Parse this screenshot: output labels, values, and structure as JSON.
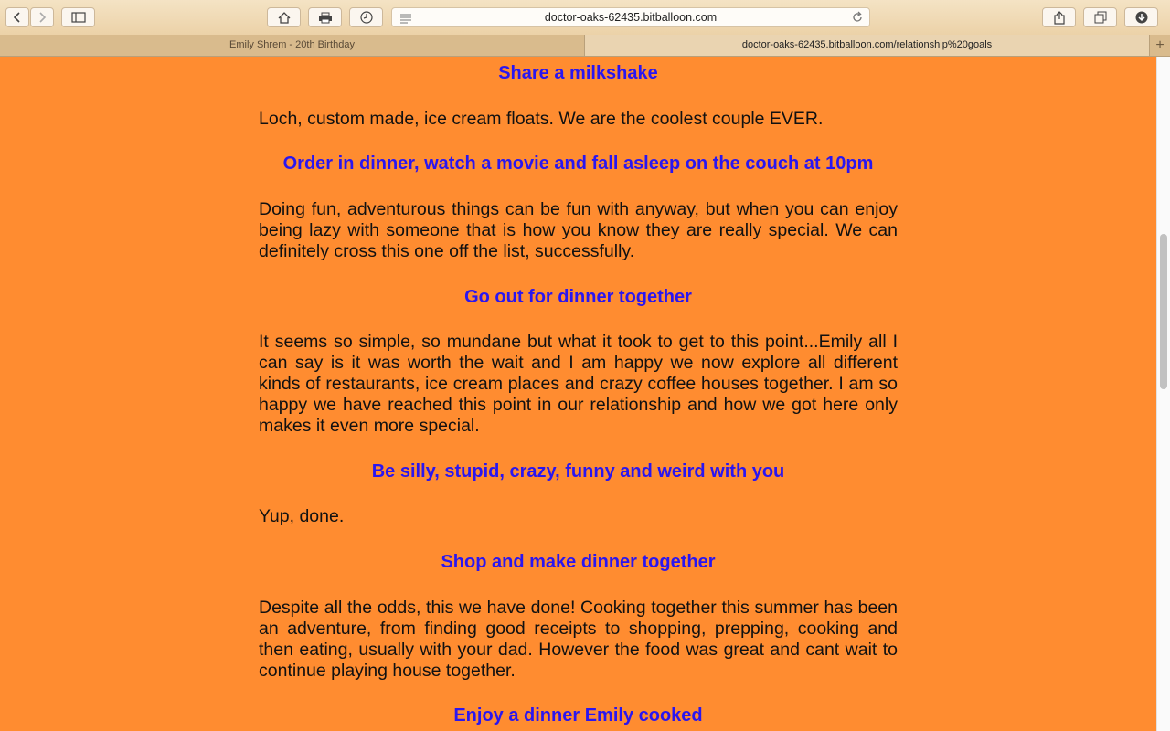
{
  "browser": {
    "url": "doctor-oaks-62435.bitballoon.com",
    "tabs": [
      {
        "label": "Emily Shrem - 20th Birthday"
      },
      {
        "label": "doctor-oaks-62435.bitballoon.com/relationship%20goals"
      }
    ],
    "new_tab": "+"
  },
  "sections": [
    {
      "heading": "Share a milkshake",
      "body": "Loch, custom made, ice cream floats. We are the coolest couple EVER."
    },
    {
      "heading": "Order in dinner, watch a movie and fall asleep on the couch at 10pm",
      "body": "Doing fun, adventurous things can be fun with anyway, but when you can enjoy being lazy with someone that is how you know they are really special. We can definitely cross this one off the list, successfully."
    },
    {
      "heading": "Go out for dinner together",
      "body": "It seems so simple, so mundane but what it took to get to this point...Emily all I can say is it was worth the wait and I am happy we now explore all different kinds of restaurants, ice cream places and crazy coffee houses together. I am so happy we have reached this point in our relationship and how we got here only makes it even more special."
    },
    {
      "heading": "Be silly, stupid, crazy, funny and weird with you",
      "body": "Yup, done."
    },
    {
      "heading": "Shop and make dinner together",
      "body": "Despite all the odds, this we have done! Cooking together this summer has been an adventure, from finding good receipts to shopping, prepping, cooking and then eating, usually with your dad. However the food was great and cant wait to continue playing house together."
    },
    {
      "heading": "Enjoy a dinner Emily cooked",
      "body": ""
    }
  ]
}
